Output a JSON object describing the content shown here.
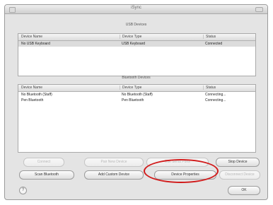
{
  "window": {
    "title": "iSync"
  },
  "usb_section": {
    "title": "USB Devices",
    "headers": [
      "Device Name",
      "Device Type",
      "Status"
    ],
    "rows": [
      [
        "No USB Keyboard",
        "USB Keyboard",
        "Connected"
      ]
    ]
  },
  "bt_section": {
    "title": "Bluetooth Devices",
    "headers": [
      "Device Name",
      "Device Type",
      "Status"
    ],
    "rows": [
      [
        "No Bluetooth (Staff)",
        "No Bluetooth (Staff)",
        "Connecting..."
      ],
      [
        "Pen Bluetooth",
        "Pen Bluetooth",
        "Connecting..."
      ]
    ]
  },
  "buttons": {
    "row1": [
      "Connect",
      "Pair New Device",
      "Edit Serial Ports",
      "Stop Device"
    ],
    "row2": [
      "Scan Bluetooth",
      "Add Custom Device",
      "Device Properties",
      "Disconnect Device"
    ],
    "help": "?",
    "ok": "OK"
  }
}
